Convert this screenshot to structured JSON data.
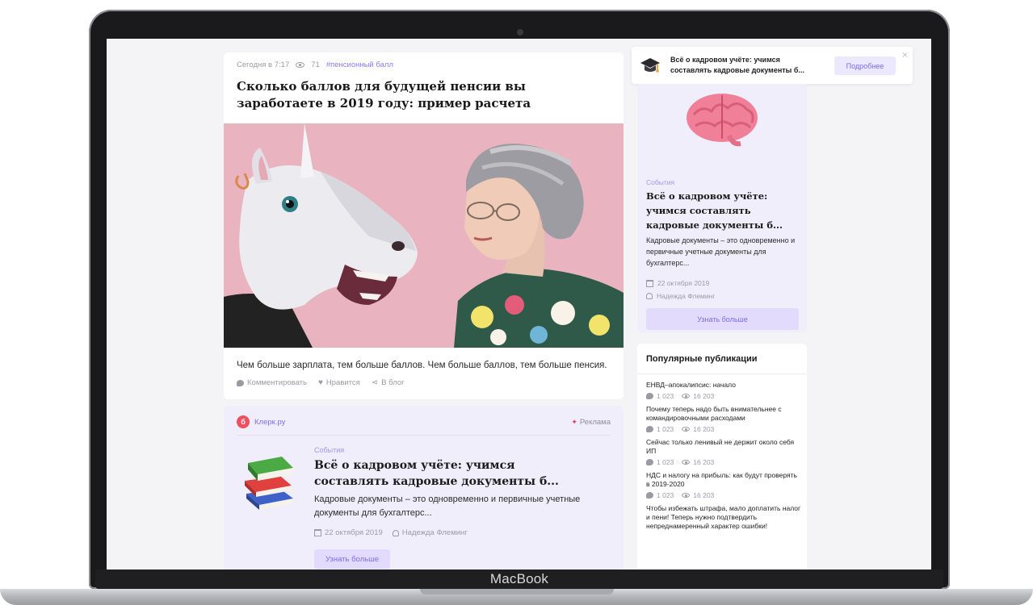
{
  "device": {
    "brand_label": "MacBook"
  },
  "article": {
    "date": "Сегодня в 7:17",
    "views": "71",
    "tag": "#пенсионный балл",
    "title": "Сколько баллов для будущей пенсии вы заработаете в 2019 году: пример расчета",
    "caption": "Чем больше зарплата, тем больше баллов. Чем больше баллов, тем больше пенсия.",
    "actions": {
      "comment": "Комментировать",
      "like": "Нравится",
      "blog": "В блог"
    }
  },
  "promo": {
    "brand": "Клерк.ру",
    "ad_label": "Реклама",
    "category": "События",
    "title": "Всё о кадровом учёте: учимся составлять кадровые документы б...",
    "description": "Кадровые документы – это одновременно и первичные учетные документы для бухгалтерс...",
    "date": "22 октября 2019",
    "author": "Надежда Флеминг",
    "button": "Узнать больше"
  },
  "banner": {
    "text": "Всё о кадровом учёте: учимся составлять кадровые документы б...",
    "button": "Подробнее",
    "close": "×"
  },
  "side_card": {
    "category": "События",
    "title": "Всё о кадровом учёте: учимся составлять кадровые документы б...",
    "description": "Кадровые документы – это одновременно и первичные учетные документы для бухгалтерс...",
    "date": "22 октября 2019",
    "author": "Надежда Флеминг",
    "button": "Узнать больше"
  },
  "popular": {
    "heading": "Популярные публикации",
    "items": [
      {
        "title": "ЕНВД–апокалипсис: начало",
        "comments": "1 023",
        "views": "16 203"
      },
      {
        "title": "Почему теперь надо быть внимательнее с командировочными расходами",
        "comments": "1 023",
        "views": "16 203"
      },
      {
        "title": "Сейчас только ленивый не держит около себя ИП",
        "comments": "1 023",
        "views": "16 203"
      },
      {
        "title": "НДС и налогу на прибыль: как будут проверять в 2019-2020",
        "comments": "1 023",
        "views": "16 203"
      },
      {
        "title": "Чтобы избежать штрафа, мало доплатить налог и пени! Теперь нужно подтвердить непреднамеренный характер ошибки!",
        "comments": "",
        "views": ""
      }
    ]
  },
  "colors": {
    "accent": "#7a6ee8",
    "promo_bg": "#f1eefc",
    "brand_red": "#ef4f5e"
  }
}
